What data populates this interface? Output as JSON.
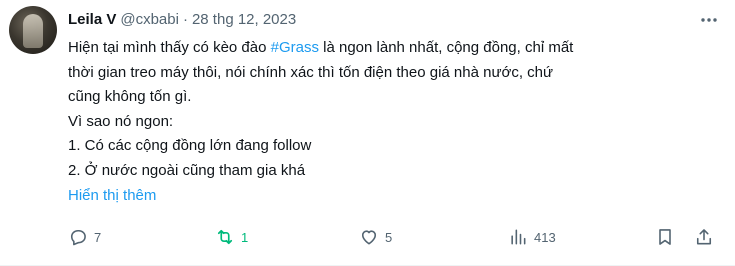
{
  "author": {
    "name": "Leila V",
    "handle": "@cxbabi",
    "separator": "·",
    "date": "28 thg 12, 2023"
  },
  "body": {
    "line1_before": "Hiện tại mình thấy có kèo đào ",
    "hashtag": "#Grass",
    "line1_after": " là ngon lành nhất, cộng đồng, chỉ mất",
    "line2": "thời gian treo máy thôi, nói chính xác thì tốn điện theo giá nhà nước, chứ",
    "line3": "cũng không tốn gì.",
    "line4": "Vì sao nó ngon:",
    "line5": "1. Có các cộng đồng lớn đang follow",
    "line6": "2. Ở nước ngoài cũng tham gia khá",
    "show_more": "Hiển thị thêm"
  },
  "actions": {
    "reply_count": "7",
    "retweet_count": "1",
    "like_count": "5",
    "views_count": "413"
  },
  "icons": {
    "more": "more-options-icon",
    "reply": "reply-icon",
    "retweet": "retweet-icon",
    "like": "heart-icon",
    "views": "views-chart-icon",
    "bookmark": "bookmark-icon",
    "share": "share-icon"
  },
  "colors": {
    "link": "#1d9bf0",
    "muted": "#536471",
    "retweeted": "#00ba7c",
    "text": "#0f1419"
  }
}
